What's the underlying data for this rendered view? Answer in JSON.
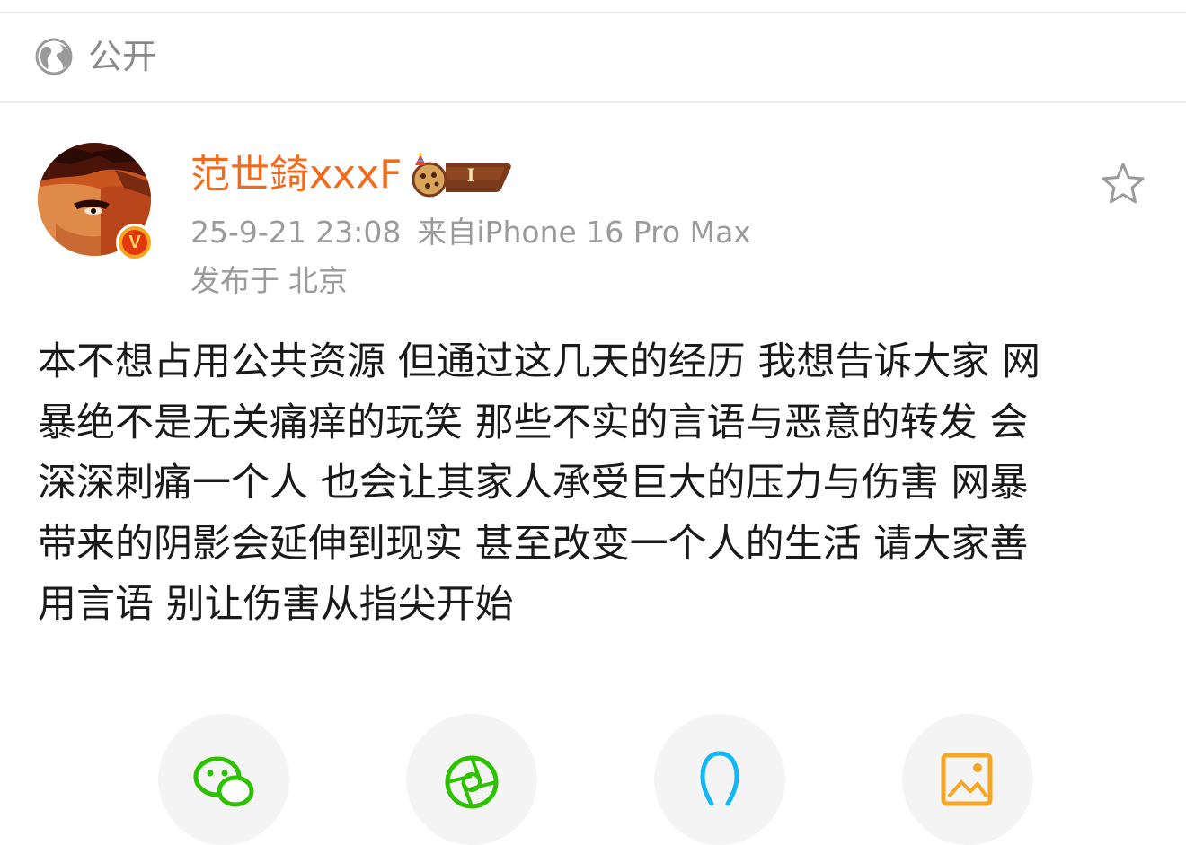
{
  "visibility": {
    "icon": "globe-icon",
    "label": "公开"
  },
  "post": {
    "author": {
      "name": "范世錡xxxF",
      "verified_icon": "verified-v-icon",
      "level_badge": {
        "icon": "cookie-party-icon",
        "level": "I"
      }
    },
    "time": "25-9-21 23:08",
    "source": "来自iPhone 16 Pro Max",
    "location_prefix": "发布于",
    "location": "北京",
    "favorite_icon": "star-icon",
    "text_lines": [
      "本不想占用公共资源 但通过这几天的经历 我想告诉大家 网",
      "暴绝不是无关痛痒的玩笑 那些不实的言语与恶意的转发 会",
      "深深刺痛一个人 也会让其家人承受巨大的压力与伤害 网暴",
      "带来的阴影会延伸到现实 甚至改变一个人的生活 请大家善",
      "用言语 别让伤害从指尖开始"
    ]
  },
  "share": {
    "items": [
      {
        "icon": "wechat-icon",
        "color": "#2dc100"
      },
      {
        "icon": "moments-icon",
        "color": "#2dc100"
      },
      {
        "icon": "qq-icon",
        "color": "#12b7f5"
      },
      {
        "icon": "save-image-icon",
        "color": "#f5a623"
      }
    ]
  },
  "colors": {
    "username": "#f26b1d",
    "meta": "#9b9b9b",
    "verified": "#f5a623"
  }
}
